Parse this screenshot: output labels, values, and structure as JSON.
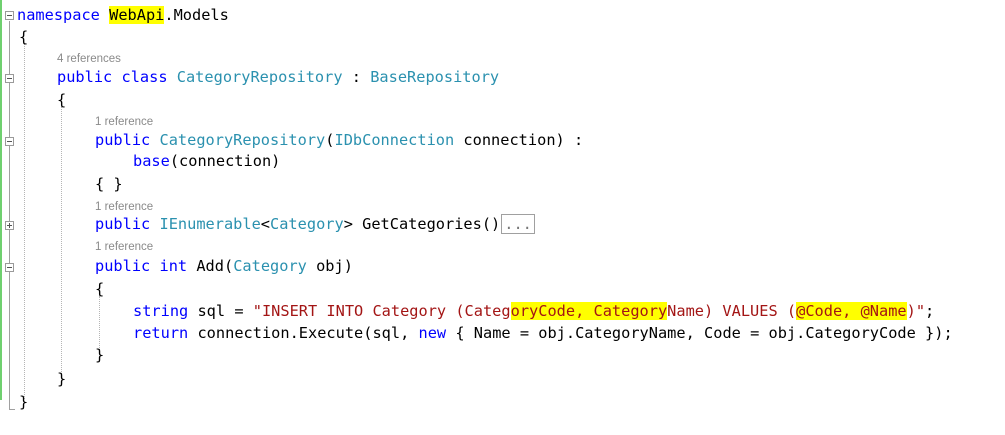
{
  "code": {
    "l1": {
      "kw": "namespace",
      "ns1": "WebApi",
      "dot": ".",
      "ns2": "Models"
    },
    "l2": {
      "text": "{"
    },
    "lens1": "4 references",
    "l3": {
      "kw1": "public",
      "kw2": "class",
      "cls": "CategoryRepository",
      "colon": " : ",
      "base": "BaseRepository"
    },
    "l4": {
      "text": "{"
    },
    "lens2": "1 reference",
    "l5": {
      "kw": "public",
      "ctor": "CategoryRepository",
      "paren": "(",
      "type": "IDbConnection",
      "rest": " connection) :"
    },
    "l6": {
      "kw": "base",
      "rest": "(connection)"
    },
    "l7": {
      "text": "{ }"
    },
    "lens3": "1 reference",
    "l8": {
      "kw": "public",
      "type1": "IEnumerable",
      "lt": "<",
      "type2": "Category",
      "rest": "> GetCategories()",
      "collapsed": "..."
    },
    "lens4": "1 reference",
    "l9": {
      "kw1": "public",
      "kw2": "int",
      "method": " Add(",
      "type": "Category",
      "rest": " obj)"
    },
    "l10": {
      "text": "{"
    },
    "l11": {
      "kw": "string",
      "assign": " sql = ",
      "s1": "\"INSERT INTO Category (Categ",
      "s2": "oryCode, Category",
      "s3": "Name) VALUES (",
      "s4": "@Code, @Name",
      "s5": ")\"",
      "end": ";"
    },
    "l12": {
      "kw": "return",
      "rest1": " connection.Execute(sql, ",
      "kw2": "new",
      "rest2": " { Name = obj.CategoryName, Code = obj.CategoryCode });"
    },
    "l13": {
      "text": "}"
    },
    "l14": {
      "text": "}"
    },
    "l15": {
      "text": "}"
    }
  }
}
